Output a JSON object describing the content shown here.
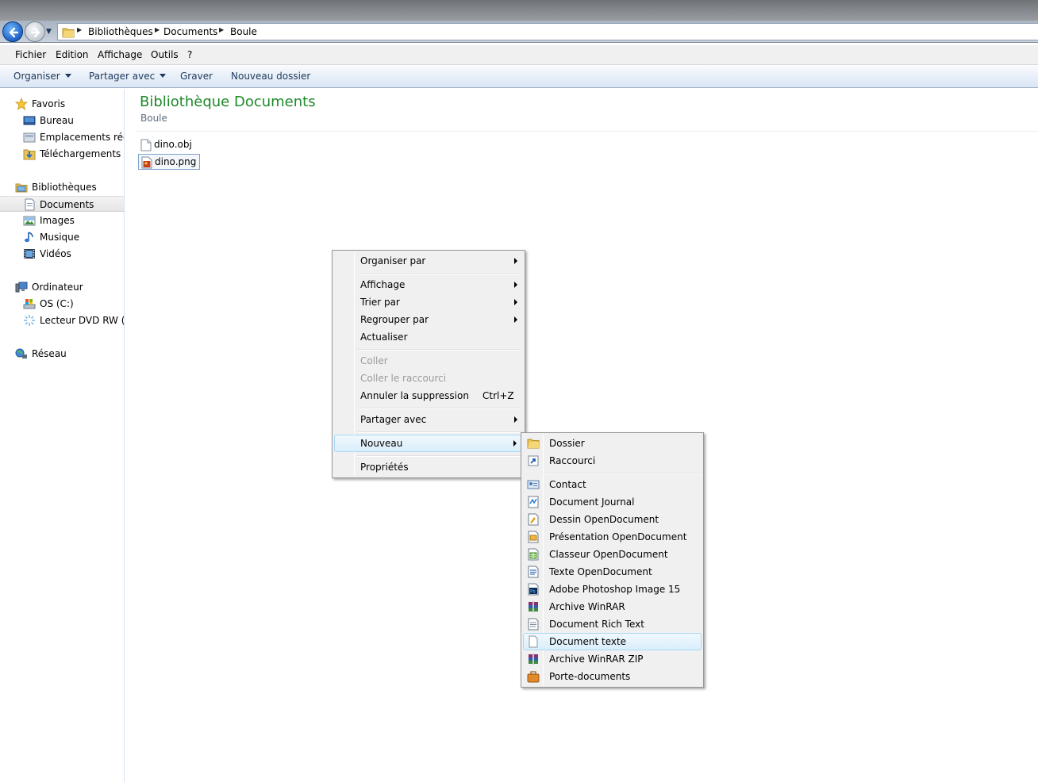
{
  "address": {
    "crumbs": [
      "Bibliothèques",
      "Documents",
      "Boule"
    ]
  },
  "menubar": [
    "Fichier",
    "Edition",
    "Affichage",
    "Outils",
    "?"
  ],
  "toolbar": {
    "organize": "Organiser",
    "share": "Partager avec",
    "burn": "Graver",
    "new_folder": "Nouveau dossier"
  },
  "nav": {
    "favorites": "Favoris",
    "desktop": "Bureau",
    "recent": "Emplacements récents",
    "downloads": "Téléchargements",
    "libraries": "Bibliothèques",
    "documents": "Documents",
    "images": "Images",
    "music": "Musique",
    "videos": "Vidéos",
    "computer": "Ordinateur",
    "os_c": "OS (C:)",
    "dvd": "Lecteur DVD RW (E:)",
    "network": "Réseau"
  },
  "content": {
    "title": "Bibliothèque Documents",
    "subtitle": "Boule",
    "files": [
      "dino.obj",
      "dino.png"
    ]
  },
  "context_menu": {
    "organize_by": "Organiser par",
    "view": "Affichage",
    "sort_by": "Trier par",
    "group_by": "Regrouper par",
    "refresh": "Actualiser",
    "paste": "Coller",
    "paste_shortcut": "Coller le raccourci",
    "undo_delete": "Annuler la suppression",
    "undo_shortcut": "Ctrl+Z",
    "share_with": "Partager avec",
    "new": "Nouveau",
    "properties": "Propriétés"
  },
  "submenu_new": {
    "folder": "Dossier",
    "shortcut": "Raccourci",
    "contact": "Contact",
    "journal": "Document Journal",
    "od_draw": "Dessin OpenDocument",
    "od_presentation": "Présentation OpenDocument",
    "od_spreadsheet": "Classeur OpenDocument",
    "od_text": "Texte OpenDocument",
    "photoshop": "Adobe Photoshop Image 15",
    "winrar": "Archive WinRAR",
    "rtf": "Document Rich Text",
    "text": "Document texte",
    "winrar_zip": "Archive WinRAR ZIP",
    "briefcase": "Porte-documents"
  }
}
